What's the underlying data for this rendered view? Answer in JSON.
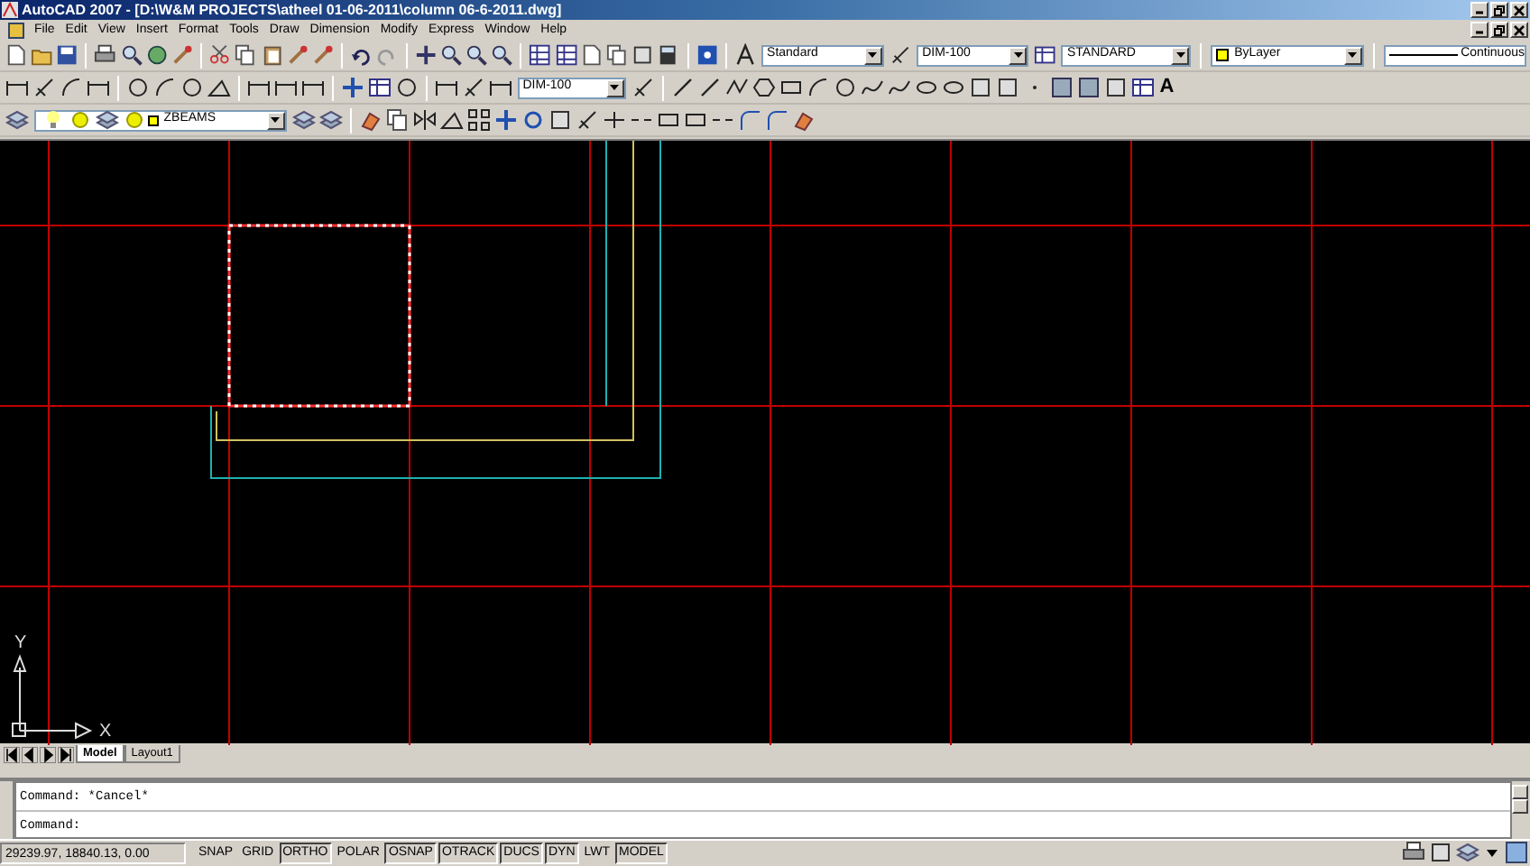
{
  "window": {
    "title": "AutoCAD 2007 - [D:\\W&M PROJECTS\\atheel 01-06-2011\\column 06-6-2011.dwg]"
  },
  "menu": [
    "File",
    "Edit",
    "View",
    "Insert",
    "Format",
    "Tools",
    "Draw",
    "Dimension",
    "Modify",
    "Express",
    "Window",
    "Help"
  ],
  "toolbars": {
    "text_style": "Standard",
    "dim_style": "DIM-100",
    "table_style": "STANDARD",
    "color_setting": "ByLayer",
    "linetype": "Continuous",
    "dim_style_2": "DIM-100",
    "layer": "ZBEAMS",
    "mtext_icon": "A"
  },
  "ucs": {
    "y_label": "Y",
    "x_label": "X"
  },
  "layout_tabs": [
    {
      "label": "Model",
      "selected": true
    },
    {
      "label": "Layout1",
      "selected": false
    }
  ],
  "command_lines": [
    "Command: *Cancel*",
    "Command:"
  ],
  "status_bar": {
    "coordinates": "29239.97, 18840.13, 0.00",
    "toggles": [
      {
        "label": "SNAP",
        "on": false
      },
      {
        "label": "GRID",
        "on": false
      },
      {
        "label": "ORTHO",
        "on": true
      },
      {
        "label": "POLAR",
        "on": false
      },
      {
        "label": "OSNAP",
        "on": true
      },
      {
        "label": "OTRACK",
        "on": true
      },
      {
        "label": "DUCS",
        "on": true
      },
      {
        "label": "DYN",
        "on": true
      },
      {
        "label": "LWT",
        "on": false
      },
      {
        "label": "MODEL",
        "on": true
      }
    ]
  }
}
